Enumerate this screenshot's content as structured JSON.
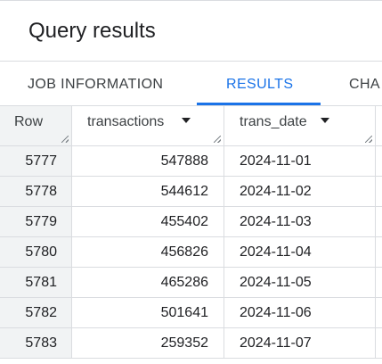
{
  "panel": {
    "title": "Query results"
  },
  "tabs": [
    {
      "label": "JOB INFORMATION",
      "active": false
    },
    {
      "label": "RESULTS",
      "active": true
    },
    {
      "label": "CHA",
      "active": false
    }
  ],
  "table": {
    "columns": [
      {
        "label": "Row"
      },
      {
        "label": "transactions"
      },
      {
        "label": "trans_date"
      }
    ],
    "rows": [
      {
        "row": "5777",
        "transactions": "547888",
        "trans_date": "2024-11-01"
      },
      {
        "row": "5778",
        "transactions": "544612",
        "trans_date": "2024-11-02"
      },
      {
        "row": "5779",
        "transactions": "455402",
        "trans_date": "2024-11-03"
      },
      {
        "row": "5780",
        "transactions": "456826",
        "trans_date": "2024-11-04"
      },
      {
        "row": "5781",
        "transactions": "465286",
        "trans_date": "2024-11-05"
      },
      {
        "row": "5782",
        "transactions": "501641",
        "trans_date": "2024-11-06"
      },
      {
        "row": "5783",
        "transactions": "259352",
        "trans_date": "2024-11-07"
      }
    ]
  },
  "colors": {
    "accent": "#1a73e8",
    "border": "#dadce0",
    "row_header_bg": "#f1f3f4",
    "text": "#202124"
  }
}
